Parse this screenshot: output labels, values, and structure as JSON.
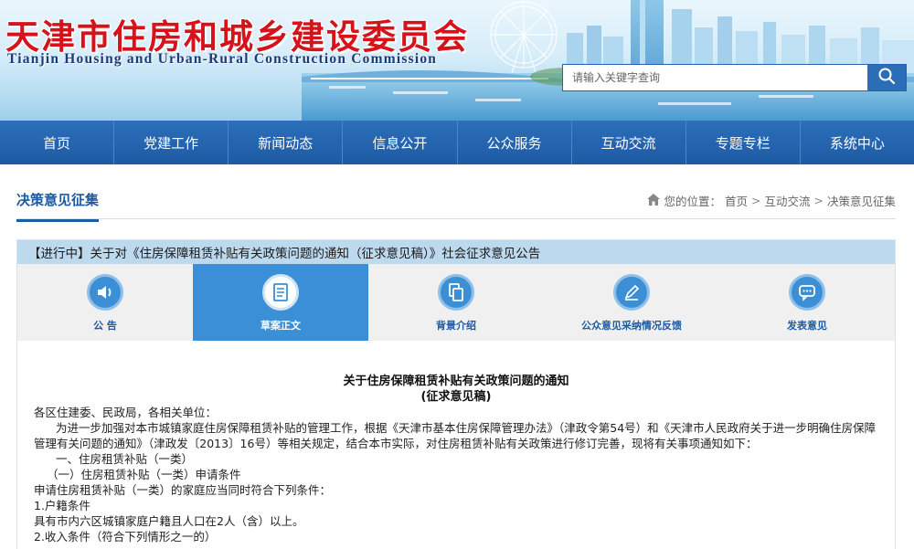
{
  "header": {
    "title": "天津市住房和城乡建设委员会",
    "subtitle": "Tianjin Housing and Urban-Rural Construction Commission"
  },
  "search": {
    "placeholder": "请输入关键字查询",
    "icon": "search-icon"
  },
  "nav": {
    "items": [
      "首页",
      "党建工作",
      "新闻动态",
      "信息公开",
      "公众服务",
      "互动交流",
      "专题专栏",
      "系统中心"
    ]
  },
  "section": {
    "title": "决策意见征集"
  },
  "breadcrumb": {
    "prefix": "您的位置：",
    "items": [
      "首页",
      "互动交流",
      "决策意见征集"
    ],
    "separator": ">",
    "icon": "home-icon"
  },
  "consultation": {
    "heading": "【进行中】关于对《住房保障租赁补贴有关政策问题的通知（征求意见稿）》社会征求意见公告",
    "tabs": [
      {
        "label": "公  告",
        "icon": "speaker-icon",
        "active": false
      },
      {
        "label": "草案正文",
        "icon": "document-icon",
        "active": true
      },
      {
        "label": "背景介绍",
        "icon": "copy-icon",
        "active": false
      },
      {
        "label": "公众意见采纳情况反馈",
        "icon": "edit-icon",
        "active": false
      },
      {
        "label": "发表意见",
        "icon": "comment-icon",
        "active": false
      }
    ]
  },
  "document": {
    "title": "关于住房保障租赁补贴有关政策问题的通知",
    "subtitle": "(征求意见稿)",
    "paragraphs": [
      "各区住建委、民政局，各相关单位：",
      "为进一步加强对本市城镇家庭住房保障租赁补贴的管理工作，根据《天津市基本住房保障管理办法》（津政令第54号）和《天津市人民政府关于进一步明确住房保障管理有关问题的通知》（津政发〔2013〕16号）等相关规定，结合本市实际，对住房租赁补贴有关政策进行修订完善，现将有关事项通知如下：",
      "一、住房租赁补贴（一类）",
      "（一）住房租赁补贴（一类）申请条件",
      "申请住房租赁补贴（一类）的家庭应当同时符合下列条件：",
      "1.户籍条件",
      "具有市内六区城镇家庭户籍且人口在2人（含）以上。",
      "2.收入条件（符合下列情形之一的）"
    ]
  },
  "colors": {
    "brand_red": "#d6121a",
    "nav_blue": "#1d5aa4",
    "active_tab": "#3a8fd6",
    "panel_head": "#bcd9ee"
  }
}
